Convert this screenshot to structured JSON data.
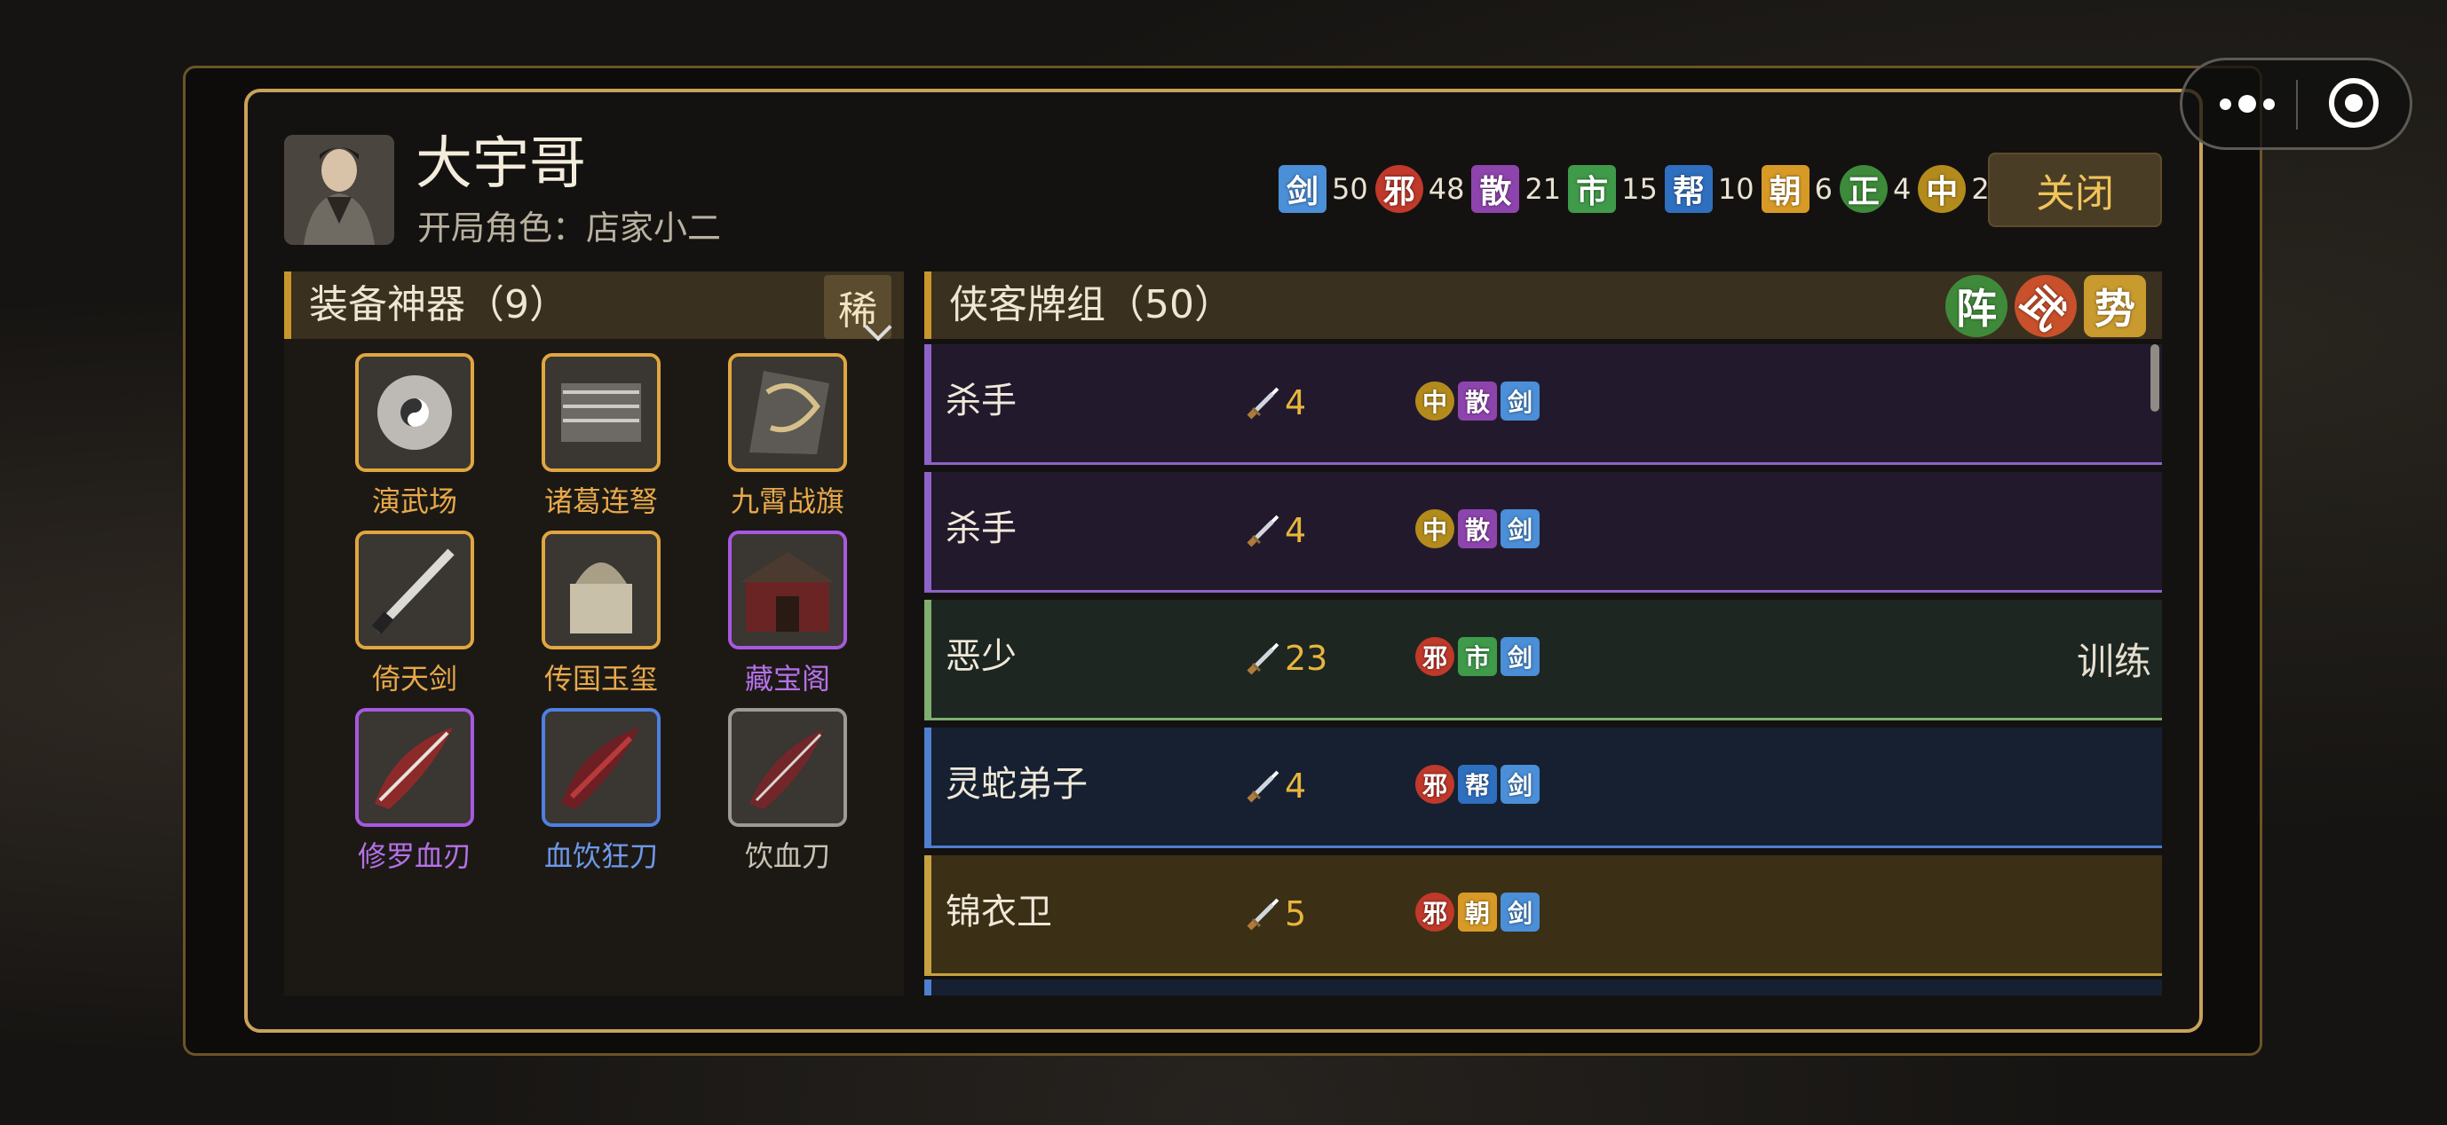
{
  "player": {
    "name": "大宇哥",
    "start_role_label": "开局角色：",
    "start_role": "店家小二"
  },
  "faction_counts": [
    {
      "glyph": "剑",
      "count": "50",
      "color": "#4a8fd8",
      "shape": "diamond"
    },
    {
      "glyph": "邪",
      "count": "48",
      "color": "#c0392b",
      "shape": "round"
    },
    {
      "glyph": "散",
      "count": "21",
      "color": "#8e44ad",
      "shape": "square"
    },
    {
      "glyph": "市",
      "count": "15",
      "color": "#3f9a4a",
      "shape": "square"
    },
    {
      "glyph": "帮",
      "count": "10",
      "color": "#2f6fc0",
      "shape": "square"
    },
    {
      "glyph": "朝",
      "count": "6",
      "color": "#d79a26",
      "shape": "square"
    },
    {
      "glyph": "正",
      "count": "4",
      "color": "#3d8a3a",
      "shape": "round"
    },
    {
      "glyph": "中",
      "count": "2",
      "color": "#b38b1c",
      "shape": "round"
    }
  ],
  "close_label": "关闭",
  "artifacts_section": {
    "title": "装备神器（9）",
    "rare_label": "稀",
    "items": [
      {
        "name": "演武场",
        "rarity": "gold"
      },
      {
        "name": "诸葛连弩",
        "rarity": "gold"
      },
      {
        "name": "九霄战旗",
        "rarity": "gold"
      },
      {
        "name": "倚天剑",
        "rarity": "gold"
      },
      {
        "name": "传国玉玺",
        "rarity": "gold"
      },
      {
        "name": "藏宝阁",
        "rarity": "purple"
      },
      {
        "name": "修罗血刃",
        "rarity": "purple"
      },
      {
        "name": "血饮狂刀",
        "rarity": "blue"
      },
      {
        "name": "饮血刀",
        "rarity": "gray"
      }
    ]
  },
  "deck_section": {
    "title": "侠客牌组（50）",
    "icons": [
      {
        "glyph": "阵",
        "color": "#3f8a3a"
      },
      {
        "glyph": "武",
        "color": "#c8502a"
      },
      {
        "glyph": "势",
        "color": "#c99a2e"
      }
    ],
    "cards": [
      {
        "name": "杀手",
        "power": "4",
        "tags": [
          "中",
          "散",
          "剑"
        ],
        "bg": "#221a2c",
        "accent": "#8e63c7",
        "action": ""
      },
      {
        "name": "杀手",
        "power": "4",
        "tags": [
          "中",
          "散",
          "剑"
        ],
        "bg": "#221a2c",
        "accent": "#8e63c7",
        "action": ""
      },
      {
        "name": "恶少",
        "power": "23",
        "tags": [
          "邪",
          "市",
          "剑"
        ],
        "bg": "#1d2620",
        "accent": "#7fae6f",
        "action": "训练"
      },
      {
        "name": "灵蛇弟子",
        "power": "4",
        "tags": [
          "邪",
          "帮",
          "剑"
        ],
        "bg": "#162031",
        "accent": "#4f7fce",
        "action": ""
      },
      {
        "name": "锦衣卫",
        "power": "5",
        "tags": [
          "邪",
          "朝",
          "剑"
        ],
        "bg": "#3b2f15",
        "accent": "#c7a140",
        "action": ""
      }
    ]
  },
  "tag_colors": {
    "中": "#b38b1c",
    "散": "#8e44ad",
    "剑": "#4a8fd8",
    "邪": "#c0392b",
    "市": "#3f9a4a",
    "帮": "#2f6fc0",
    "朝": "#d79a26",
    "正": "#3d8a3a"
  }
}
